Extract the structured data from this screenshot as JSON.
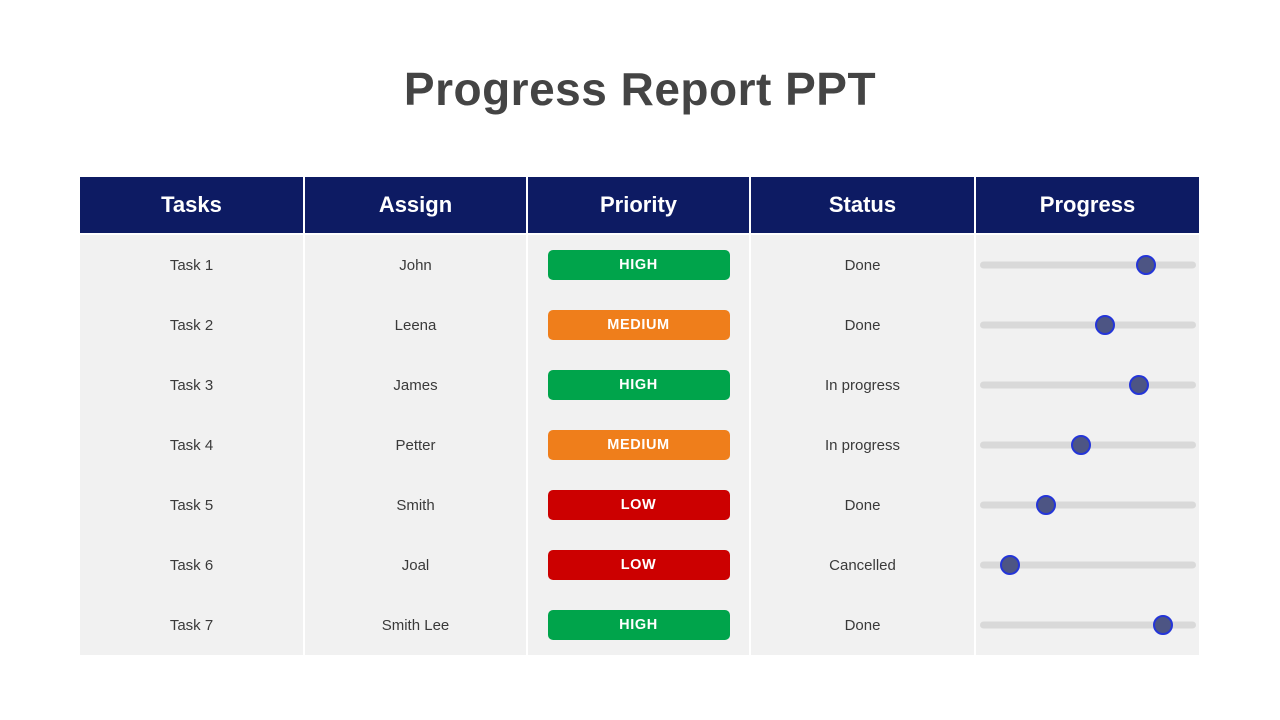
{
  "slide": {
    "title": "Progress Report PPT"
  },
  "table": {
    "columns": [
      {
        "key": "tasks",
        "label": "Tasks"
      },
      {
        "key": "assign",
        "label": "Assign"
      },
      {
        "key": "priority",
        "label": "Priority"
      },
      {
        "key": "status",
        "label": "Status"
      },
      {
        "key": "progress",
        "label": "Progress"
      }
    ],
    "header_bg": "#0d1b63",
    "row_bg": "#f1f1f1",
    "priority_colors": {
      "HIGH": "#00a44b",
      "MEDIUM": "#ef7e1b",
      "LOW": "#cc0000"
    },
    "slider_colors": {
      "track": "#d9d9d9",
      "thumb_fill": "#4d5584",
      "thumb_ring": "#2435d8"
    },
    "rows": [
      {
        "tasks": "Task 1",
        "assign": "John",
        "priority": "HIGH",
        "status": "Done",
        "progress": 77
      },
      {
        "tasks": "Task 2",
        "assign": "Leena",
        "priority": "MEDIUM",
        "status": "Done",
        "progress": 58
      },
      {
        "tasks": "Task 3",
        "assign": "James",
        "priority": "HIGH",
        "status": "In progress",
        "progress": 74
      },
      {
        "tasks": "Task 4",
        "assign": "Petter",
        "priority": "MEDIUM",
        "status": "In progress",
        "progress": 47
      },
      {
        "tasks": "Task 5",
        "assign": "Smith",
        "priority": "LOW",
        "status": "Done",
        "progress": 31
      },
      {
        "tasks": "Task 6",
        "assign": "Joal",
        "priority": "LOW",
        "status": "Cancelled",
        "progress": 14
      },
      {
        "tasks": "Task 7",
        "assign": "Smith Lee",
        "priority": "HIGH",
        "status": "Done",
        "progress": 85
      }
    ]
  }
}
